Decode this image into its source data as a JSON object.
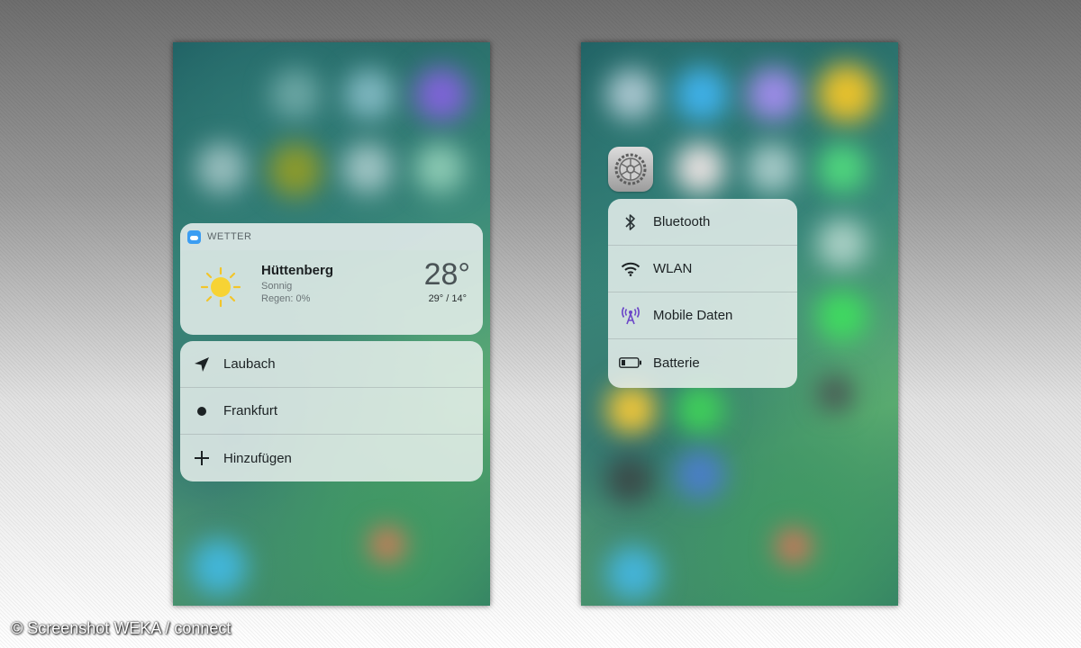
{
  "left_phone": {
    "weather_widget": {
      "app_name": "WETTER",
      "city": "Hüttenberg",
      "condition": "Sonnig",
      "rain": "Regen: 0%",
      "temperature": "28°",
      "range": "29° / 14°"
    },
    "menu": [
      {
        "icon": "location-arrow-icon",
        "label": "Laubach"
      },
      {
        "icon": "dot-icon",
        "label": "Frankfurt"
      },
      {
        "icon": "plus-icon",
        "label": "Hinzufügen"
      }
    ]
  },
  "right_phone": {
    "app_icon": "settings-gear-icon",
    "menu": [
      {
        "icon": "bluetooth-icon",
        "label": "Bluetooth"
      },
      {
        "icon": "wifi-icon",
        "label": "WLAN"
      },
      {
        "icon": "cellular-antenna-icon",
        "label": "Mobile Daten"
      },
      {
        "icon": "battery-icon",
        "label": "Batterie"
      }
    ]
  },
  "credit": "© Screenshot WEKA / connect",
  "colors": {
    "weather_app_icon": "#3b9df2",
    "sun": "#f7d334",
    "mobile_data_icon": "#6b46c8"
  }
}
